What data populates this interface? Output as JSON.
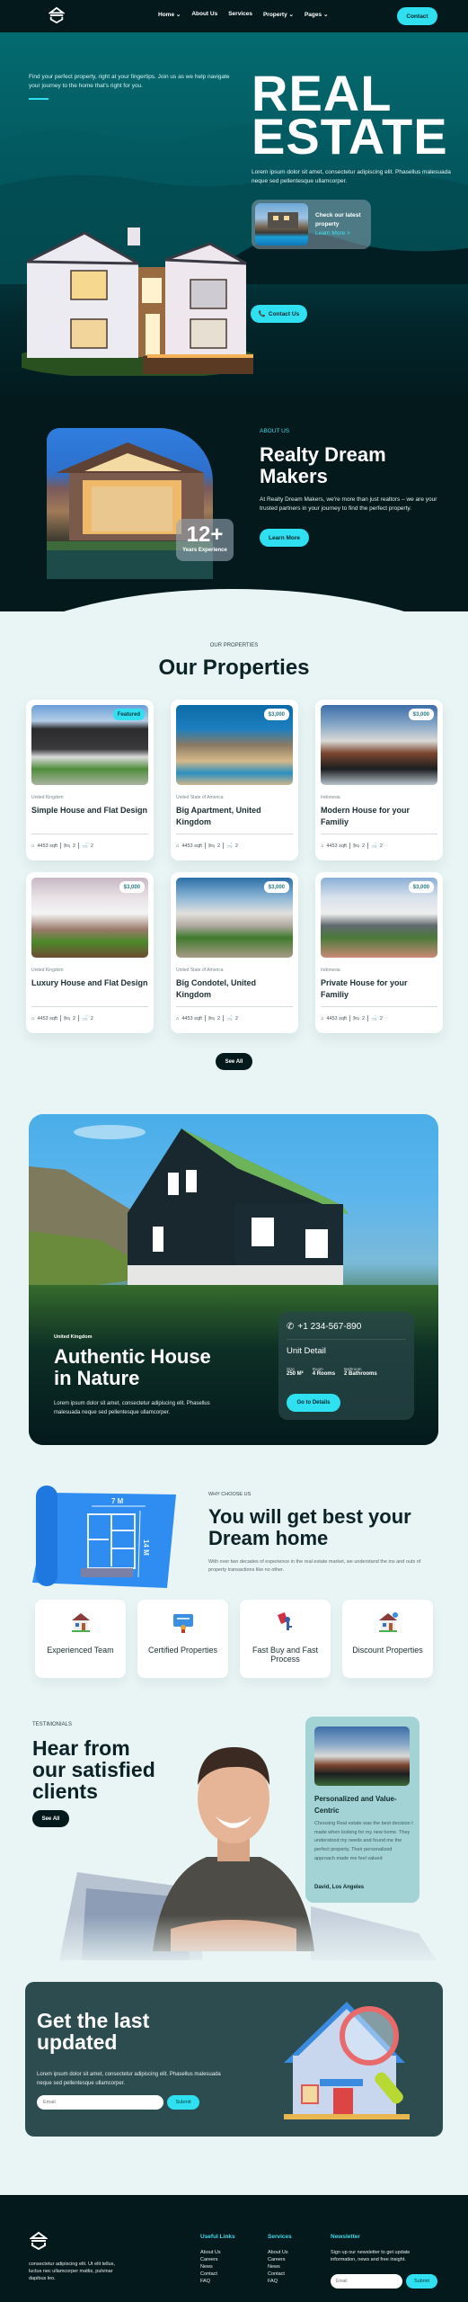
{
  "nav": {
    "links": [
      {
        "label": "Home",
        "dropdown": true
      },
      {
        "label": "About Us",
        "dropdown": false
      },
      {
        "label": "Services",
        "dropdown": false
      },
      {
        "label": "Property",
        "dropdown": true
      },
      {
        "label": "Pages",
        "dropdown": true
      }
    ],
    "contact_label": "Contact"
  },
  "hero": {
    "intro": "Find your perfect property, right at your fingertips. Join us as we help navigate your journey to the home that's right for you.",
    "title_line1": "REAL",
    "title_line2": "ESTATE",
    "description": "Lorem ipsum dolor sit amet, consectetur adipiscing elit. Phasellus malesuada neque sed pellentesque ullamcorper.",
    "latest_title": "Check our latest property",
    "latest_link": "Learn More >",
    "contact_label": "Contact Us"
  },
  "about": {
    "tag": "ABOUT US",
    "title": "Realty Dream Makers",
    "description": "At Realty Dream Makers, we're more than just realtors – we are your trusted partners in your journey to find the perfect property.",
    "button": "Learn More",
    "experience_value": "12+",
    "experience_label": "Years Experience"
  },
  "properties": {
    "tag": "OUR PROPERTIES",
    "title": "Our Properties",
    "see_all": "See All",
    "items": [
      {
        "badge": "Featured",
        "badge_type": "featured",
        "location": "United Kingdom",
        "title": "Simple House and Flat Design",
        "area": "4453 sqft",
        "beds": "2",
        "baths": "2"
      },
      {
        "badge": "$3,000",
        "badge_type": "price",
        "location": "United State of America",
        "title": "Big Apartment, United Kingdom",
        "area": "4453 sqft",
        "beds": "2",
        "baths": "2"
      },
      {
        "badge": "$3,000",
        "badge_type": "price",
        "location": "Indonesia",
        "title": "Modern House for your Familiy",
        "area": "4453 sqft",
        "beds": "2",
        "baths": "2"
      },
      {
        "badge": "$3,000",
        "badge_type": "price",
        "location": "United Kingdom",
        "title": "Luxury House and Flat Design",
        "area": "4453 sqft",
        "beds": "2",
        "baths": "2"
      },
      {
        "badge": "$3,000",
        "badge_type": "price",
        "location": "United State of America",
        "title": "Big Condotel, United Kingdom",
        "area": "4453 sqft",
        "beds": "2",
        "baths": "2"
      },
      {
        "badge": "$3,000",
        "badge_type": "price",
        "location": "Indonesia",
        "title": "Private House for your Familiy",
        "area": "4453 sqft",
        "beds": "2",
        "baths": "2"
      }
    ]
  },
  "nature": {
    "tag": "United Kingdom",
    "title": "Authentic House in Nature",
    "description": "Lorem ipsum dolor sit amet, consectetur adipiscing elit. Phasellus malesuada neque sed pellentesque ullamcorper.",
    "phone": "+1 234-567-890",
    "unit_title": "Unit Detail",
    "stats": [
      {
        "label": "Size",
        "value": "250 M²"
      },
      {
        "label": "Room",
        "value": "4 Rooms"
      },
      {
        "label": "Bathroom",
        "value": "2 Bathrooms"
      }
    ],
    "button": "Go to Details"
  },
  "why": {
    "tag": "WHY CHOOSE US",
    "title": "You will get best your Dream home",
    "description": "With over two decades of experience in the real estate market, we understand the ins and outs of property transactions like no other.",
    "plan_width_label": "7 M",
    "plan_height_label": "14 M",
    "features": [
      {
        "icon": "house-team-icon",
        "label": "Experienced Team"
      },
      {
        "icon": "certificate-icon",
        "label": "Certified Properties"
      },
      {
        "icon": "key-tag-icon",
        "label": "Fast Buy and Fast Process"
      },
      {
        "icon": "discount-house-icon",
        "label": "Discount Properties"
      }
    ]
  },
  "testimonials": {
    "tag": "TESTIMONIALS",
    "title": "Hear from our satisfied clients",
    "button": "See All",
    "card_title": "Personalized and Value-Centric",
    "card_text": "Choosing Real estate was the best decision I made when looking for my new home. They understood my needs and found me the perfect property. Their personalized approach made me feel valued",
    "card_author": "David, Los Angeles"
  },
  "newsletter": {
    "title": "Get the last updated",
    "description": "Lorem ipsum dolor sit amet, consectetur adipiscing elit. Phasellus malesuada neque sed pellentesque ullamcorper.",
    "email_placeholder": "Email",
    "submit": "Submit"
  },
  "footer": {
    "description": " consectetur adipiscing elit. Ut elit tellus, luctus nec ullamcorper mattis, pulvinar dapibus leo.",
    "useful_links_title": "Useful Links",
    "useful_links": [
      "About Us",
      "Careers",
      "News",
      "Contact",
      "FAQ"
    ],
    "services_title": "Services",
    "services": [
      "About Us",
      "Careers",
      "News",
      "Contact",
      "FAQ"
    ],
    "newsletter_title": "Newsletter",
    "newsletter_text": "Sign up our newsletter to get update information, news and free insight.",
    "email_placeholder": "Email",
    "submit": "Submit"
  },
  "colors": {
    "accent": "#2ee0f0",
    "dark": "#04191b",
    "hero_teal": "#036b70",
    "light_bg": "#e9f4f4"
  }
}
